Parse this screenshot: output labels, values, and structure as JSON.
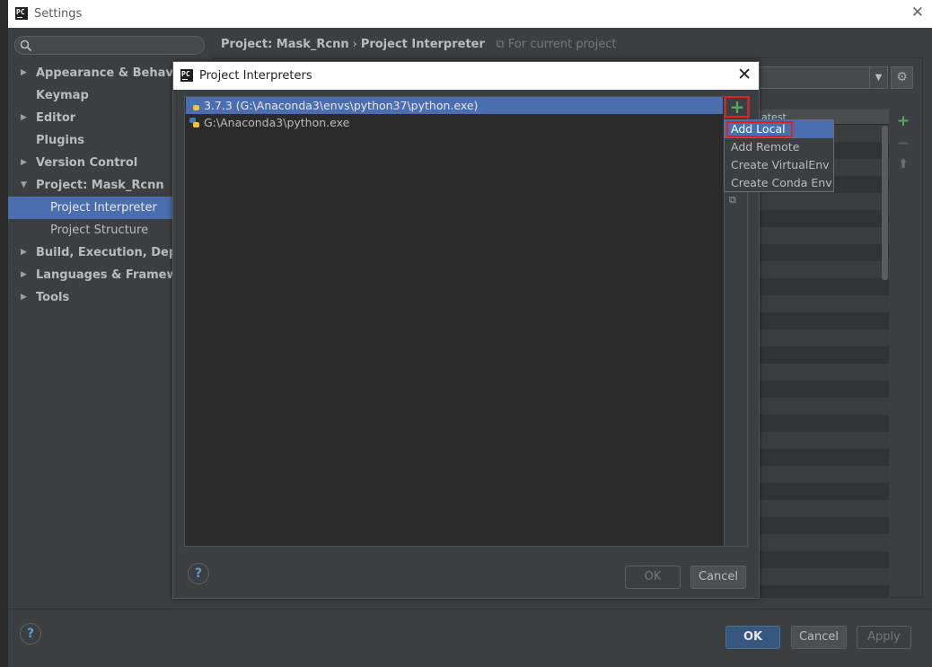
{
  "settings_window": {
    "title": "Settings",
    "app_logo_text": "PC"
  },
  "sidebar": {
    "items": [
      {
        "label": "Appearance & Behavior"
      },
      {
        "label": "Keymap"
      },
      {
        "label": "Editor"
      },
      {
        "label": "Plugins"
      },
      {
        "label": "Version Control"
      },
      {
        "label": "Project: Mask_Rcnn"
      },
      {
        "label": "Project Interpreter"
      },
      {
        "label": "Project Structure"
      },
      {
        "label": "Build, Execution, Deployment"
      },
      {
        "label": "Languages & Frameworks"
      },
      {
        "label": "Tools"
      }
    ]
  },
  "breadcrumb": {
    "project": "Project: Mask_Rcnn",
    "separator": "›",
    "page": "Project Interpreter",
    "scope": "For current project"
  },
  "package_table": {
    "header": "atest"
  },
  "footer": {
    "ok_label": "OK",
    "cancel_label": "Cancel",
    "apply_label": "Apply",
    "help": "?"
  },
  "dialog": {
    "title": "Project Interpreters",
    "interpreters": [
      {
        "label": "3.7.3 (G:\\Anaconda3\\envs\\python37\\python.exe)"
      },
      {
        "label": "G:\\Anaconda3\\python.exe"
      }
    ],
    "ok_label": "OK",
    "cancel_label": "Cancel",
    "help": "?"
  },
  "add_menu": {
    "items": [
      {
        "label": "Add Local"
      },
      {
        "label": "Add Remote"
      },
      {
        "label": "Create VirtualEnv"
      },
      {
        "label": "Create Conda Env"
      }
    ]
  },
  "colors": {
    "selection": "#4b6eaf",
    "highlight_outline": "#e02020",
    "add_icon": "#59a869"
  }
}
